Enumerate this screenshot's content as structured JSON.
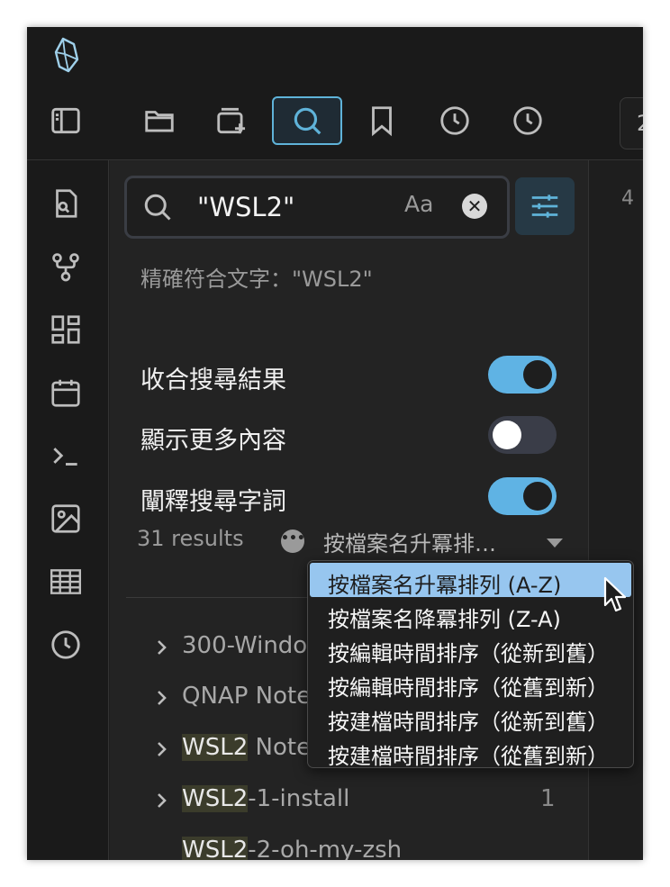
{
  "ribbon": {
    "tab_stub_label": "2",
    "buttons": [
      {
        "name": "sidebar-toggle",
        "icon": "sidebar-icon",
        "active": false
      },
      {
        "name": "files",
        "icon": "folder-icon",
        "active": false
      },
      {
        "name": "new-note",
        "icon": "card-plus-icon",
        "active": false
      },
      {
        "name": "search",
        "icon": "search-icon",
        "active": true
      },
      {
        "name": "bookmarks",
        "icon": "bookmark-icon",
        "active": false
      },
      {
        "name": "recent-1",
        "icon": "clock-icon",
        "active": false
      },
      {
        "name": "recent-2",
        "icon": "clock-icon",
        "active": false
      }
    ]
  },
  "leftbar": {
    "icons": [
      "file-search-icon",
      "graph-icon",
      "dashboard-icon",
      "calendar-icon",
      "terminal-icon",
      "image-icon",
      "table-icon",
      "clock-icon"
    ]
  },
  "search": {
    "query": "\"WSL2\"",
    "case_label": "Aa",
    "clear_label": "✕",
    "exact_match_text": "精確符合文字：\"WSL2\""
  },
  "toggles": [
    {
      "label": "收合搜尋結果",
      "on": true
    },
    {
      "label": "顯示更多內容",
      "on": false
    },
    {
      "label": "闡釋搜尋字詞",
      "on": true
    }
  ],
  "results": {
    "count_text": "31 results",
    "more_label": "•••",
    "sort_value": "按檔案名升冪排…"
  },
  "tree": [
    {
      "highlight": "",
      "rest": "300-Windo",
      "count": "",
      "chevron": true
    },
    {
      "highlight": "",
      "rest": "QNAP Note",
      "count": "",
      "chevron": true
    },
    {
      "highlight": "WSL2",
      "rest": " Note",
      "count": "",
      "chevron": true
    },
    {
      "highlight": "WSL2",
      "rest": "-1-install",
      "count": "1",
      "chevron": true
    },
    {
      "highlight": "WSL2",
      "rest": "-2-oh-my-zsh",
      "count": "",
      "chevron": false
    }
  ],
  "sort_menu": {
    "items": [
      {
        "label": "按檔案名升冪排列 (A-Z)",
        "selected": true
      },
      {
        "label": "按檔案名降冪排列 (Z-A)",
        "selected": false
      },
      {
        "label": "按編輯時間排序（從新到舊）",
        "selected": false
      },
      {
        "label": "按編輯時間排序（從舊到新）",
        "selected": false
      },
      {
        "label": "按建檔時間排序（從新到舊）",
        "selected": false
      },
      {
        "label": "按建檔時間排序（從舊到新）",
        "selected": false
      }
    ]
  },
  "editor": {
    "line_number": "4"
  },
  "colors": {
    "accent": "#5fb3e4",
    "highlight_bg": "#3b3c2b",
    "menu_selected": "#97c6ef",
    "panel_bg": "#232323"
  }
}
